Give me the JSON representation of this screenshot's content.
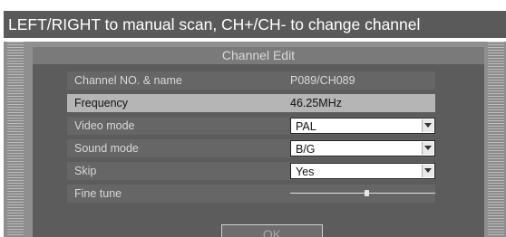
{
  "hint_bar": {
    "text": "LEFT/RIGHT to manual scan, CH+/CH- to change channel"
  },
  "dialog": {
    "title": "Channel Edit",
    "rows": [
      {
        "label": "Channel NO. & name",
        "value": "P089/CH089"
      },
      {
        "label": "Frequency",
        "value": "46.25MHz"
      },
      {
        "label": "Video mode",
        "value": "PAL"
      },
      {
        "label": "Sound mode",
        "value": "B/G"
      },
      {
        "label": "Skip",
        "value": "Yes"
      },
      {
        "label": "Fine tune",
        "level": 0.53
      }
    ],
    "ok_label": "OK"
  },
  "colors": {
    "panel_bg": "#5c5c5c",
    "selected_row": "#b5b5b5",
    "title_bar": "#7a7a7a"
  }
}
